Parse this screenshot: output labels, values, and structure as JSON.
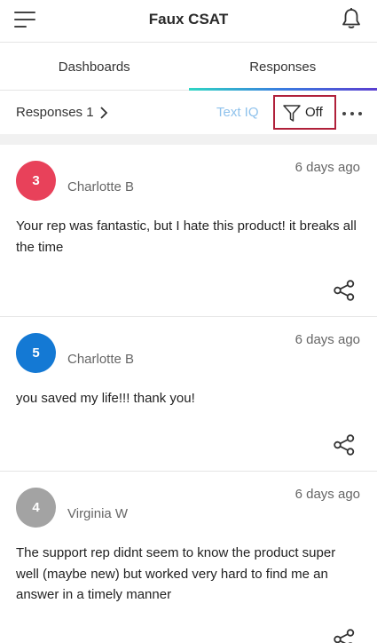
{
  "header": {
    "title": "Faux CSAT"
  },
  "tabs": [
    {
      "label": "Dashboards",
      "active": false
    },
    {
      "label": "Responses",
      "active": true
    }
  ],
  "toolbar": {
    "breadcrumb": "Responses 1",
    "text_iq": "Text IQ",
    "filter_state": "Off"
  },
  "colors": {
    "accent_underline": [
      "#2fd6c3",
      "#3a7be0",
      "#5b3fd0"
    ],
    "filter_highlight": "#b0203a",
    "text_iq": "#8fc2ec"
  },
  "responses": [
    {
      "score": "3",
      "score_color": "#e8415a",
      "name": "Charlotte B",
      "time": "6 days ago",
      "comment": "Your rep was fantastic, but I hate this product! it breaks all the time",
      "share_icon": "share-icon"
    },
    {
      "score": "5",
      "score_color": "#1479d4",
      "name": "Charlotte B",
      "time": "6 days ago",
      "comment": "you saved my life!!! thank you!",
      "share_icon": "share-icon"
    },
    {
      "score": "4",
      "score_color": "#a3a3a3",
      "name": "Virginia W",
      "time": "6 days ago",
      "comment": "The support rep didnt seem to know the product super well (maybe new) but worked very hard to find me an answer in a timely manner",
      "share_icon": "share-icon"
    }
  ]
}
